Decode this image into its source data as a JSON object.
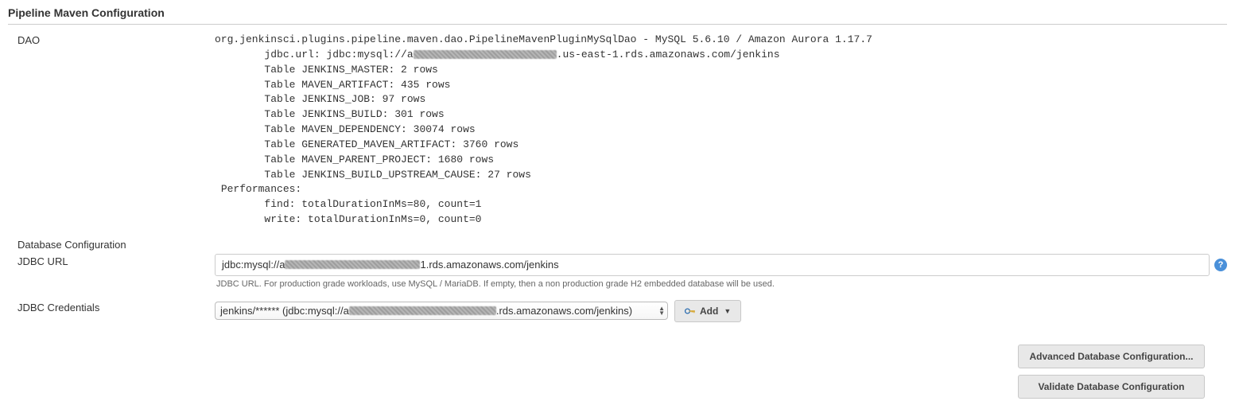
{
  "section_title": "Pipeline Maven Configuration",
  "labels": {
    "dao": "DAO",
    "db_config": "Database Configuration",
    "jdbc_url": "JDBC URL",
    "jdbc_credentials": "JDBC Credentials"
  },
  "dao": {
    "class_line": "org.jenkinsci.plugins.pipeline.maven.dao.PipelineMavenPluginMySqlDao - MySQL 5.6.10 / Amazon Aurora 1.17.7",
    "jdbc_prefix": "jdbc.url: jdbc:mysql://a",
    "jdbc_suffix": ".us-east-1.rds.amazonaws.com/jenkins",
    "tables": {
      "jenkins_master": "Table JENKINS_MASTER: 2 rows",
      "maven_artifact": "Table MAVEN_ARTIFACT: 435 rows",
      "jenkins_job": "Table JENKINS_JOB: 97 rows",
      "jenkins_build": "Table JENKINS_BUILD: 301 rows",
      "maven_dependency": "Table MAVEN_DEPENDENCY: 30074 rows",
      "generated_maven_artifact": "Table GENERATED_MAVEN_ARTIFACT: 3760 rows",
      "maven_parent_project": "Table MAVEN_PARENT_PROJECT: 1680 rows",
      "jenkins_build_upstream_cause": "Table JENKINS_BUILD_UPSTREAM_CAUSE: 27 rows"
    },
    "performances_label": "Performances:",
    "perf_find": "find: totalDurationInMs=80, count=1",
    "perf_write": "write: totalDurationInMs=0, count=0"
  },
  "jdbc_url_input": {
    "prefix": "jdbc:mysql://a",
    "suffix": "1.rds.amazonaws.com/jenkins"
  },
  "jdbc_url_help": "JDBC URL. For production grade workloads, use MySQL / MariaDB. If empty, then a non production grade H2 embedded database will be used.",
  "credentials_select": {
    "prefix": "jenkins/****** (jdbc:mysql://a",
    "suffix": ".rds.amazonaws.com/jenkins)"
  },
  "buttons": {
    "add": "Add",
    "advanced": "Advanced Database Configuration...",
    "validate": "Validate Database Configuration"
  },
  "help_icon_char": "?"
}
